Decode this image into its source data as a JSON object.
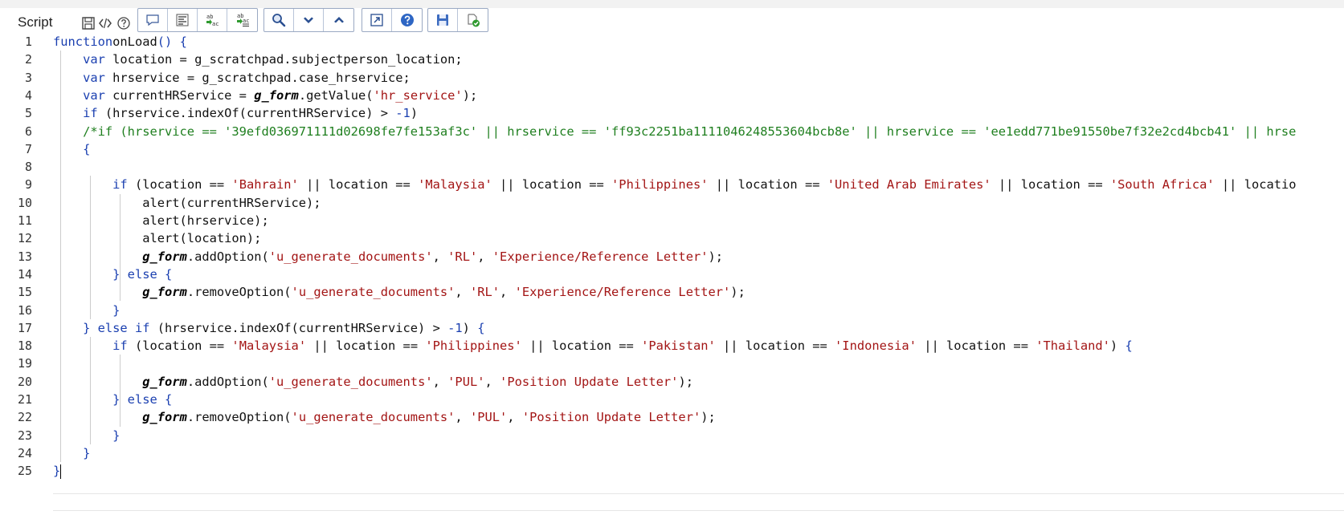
{
  "header": {
    "title": "Script"
  },
  "toolbar": {
    "mini_icons": [
      "save-icon",
      "code-icon",
      "help-icon"
    ],
    "groups": [
      [
        "comment-icon",
        "format-icon",
        "replace-icon",
        "replace-all-icon"
      ],
      [
        "search-icon",
        "next-icon",
        "previous-icon"
      ],
      [
        "fullscreen-icon",
        "help-icon"
      ],
      [
        "save-icon",
        "check-icon"
      ]
    ]
  },
  "editor": {
    "lines": [
      {
        "n": "1",
        "tokens": [
          [
            "k",
            "function"
          ],
          [
            "",
            "onLoad"
          ],
          [
            "k",
            "()"
          ],
          [
            "",
            ""
          ],
          [
            "k",
            "{"
          ]
        ]
      },
      {
        "n": "2",
        "tokens": [
          [
            "",
            "    "
          ],
          [
            "k",
            "var"
          ],
          [
            "",
            " location = g_scratchpad.subjectperson_location;"
          ]
        ]
      },
      {
        "n": "3",
        "tokens": [
          [
            "",
            "    "
          ],
          [
            "k",
            "var"
          ],
          [
            "",
            " hrservice = g_scratchpad.case_hrservice;"
          ]
        ]
      },
      {
        "n": "4",
        "tokens": [
          [
            "",
            "    "
          ],
          [
            "k",
            "var"
          ],
          [
            "",
            " currentHRService = "
          ],
          [
            "b",
            "g_form"
          ],
          [
            "",
            ".getValue("
          ],
          [
            "s",
            "'hr_service'"
          ],
          [
            "",
            ");"
          ]
        ]
      },
      {
        "n": "5",
        "tokens": [
          [
            "",
            "    "
          ],
          [
            "k",
            "if"
          ],
          [
            "",
            " (hrservice.indexOf(currentHRService) > "
          ],
          [
            "n",
            "-1"
          ],
          [
            "",
            ")"
          ]
        ]
      },
      {
        "n": "6",
        "tokens": [
          [
            "",
            "    "
          ],
          [
            "c",
            "/*if (hrservice == '39efd036971111d02698fe7fe153af3c' || hrservice == 'ff93c2251ba1111046248553604bcb8e' || hrservice == 'ee1edd771be91550be7f32e2cd4bcb41' || hrse"
          ]
        ]
      },
      {
        "n": "7",
        "tokens": [
          [
            "",
            "    "
          ],
          [
            "k",
            "{"
          ]
        ]
      },
      {
        "n": "8",
        "tokens": [
          [
            "",
            ""
          ]
        ]
      },
      {
        "n": "9",
        "tokens": [
          [
            "",
            "        "
          ],
          [
            "k",
            "if"
          ],
          [
            "",
            " (location == "
          ],
          [
            "s",
            "'Bahrain'"
          ],
          [
            "",
            " || location == "
          ],
          [
            "s",
            "'Malaysia'"
          ],
          [
            "",
            " || location == "
          ],
          [
            "s",
            "'Philippines'"
          ],
          [
            "",
            " || location == "
          ],
          [
            "s",
            "'United Arab Emirates'"
          ],
          [
            "",
            " || location == "
          ],
          [
            "s",
            "'South Africa'"
          ],
          [
            "",
            " || locatio"
          ]
        ]
      },
      {
        "n": "10",
        "tokens": [
          [
            "",
            "            alert(currentHRService);"
          ]
        ]
      },
      {
        "n": "11",
        "tokens": [
          [
            "",
            "            alert(hrservice);"
          ]
        ]
      },
      {
        "n": "12",
        "tokens": [
          [
            "",
            "            alert(location);"
          ]
        ]
      },
      {
        "n": "13",
        "tokens": [
          [
            "",
            "            "
          ],
          [
            "b",
            "g_form"
          ],
          [
            "",
            ".addOption("
          ],
          [
            "s",
            "'u_generate_documents'"
          ],
          [
            "",
            ", "
          ],
          [
            "s",
            "'RL'"
          ],
          [
            "",
            ", "
          ],
          [
            "s",
            "'Experience/Reference Letter'"
          ],
          [
            "",
            ");"
          ]
        ]
      },
      {
        "n": "14",
        "tokens": [
          [
            "",
            "        "
          ],
          [
            "k",
            "} else {"
          ]
        ]
      },
      {
        "n": "15",
        "tokens": [
          [
            "",
            "            "
          ],
          [
            "b",
            "g_form"
          ],
          [
            "",
            ".removeOption("
          ],
          [
            "s",
            "'u_generate_documents'"
          ],
          [
            "",
            ", "
          ],
          [
            "s",
            "'RL'"
          ],
          [
            "",
            ", "
          ],
          [
            "s",
            "'Experience/Reference Letter'"
          ],
          [
            "",
            ");"
          ]
        ]
      },
      {
        "n": "16",
        "tokens": [
          [
            "",
            "        "
          ],
          [
            "k",
            "}"
          ]
        ]
      },
      {
        "n": "17",
        "tokens": [
          [
            "",
            "    "
          ],
          [
            "k",
            "} else if"
          ],
          [
            "",
            " (hrservice.indexOf(currentHRService) > "
          ],
          [
            "n",
            "-1"
          ],
          [
            "",
            ") "
          ],
          [
            "k",
            "{"
          ]
        ]
      },
      {
        "n": "18",
        "tokens": [
          [
            "",
            "        "
          ],
          [
            "k",
            "if"
          ],
          [
            "",
            " (location == "
          ],
          [
            "s",
            "'Malaysia'"
          ],
          [
            "",
            " || location == "
          ],
          [
            "s",
            "'Philippines'"
          ],
          [
            "",
            " || location == "
          ],
          [
            "s",
            "'Pakistan'"
          ],
          [
            "",
            " || location == "
          ],
          [
            "s",
            "'Indonesia'"
          ],
          [
            "",
            " || location == "
          ],
          [
            "s",
            "'Thailand'"
          ],
          [
            "",
            ") "
          ],
          [
            "k",
            "{"
          ]
        ]
      },
      {
        "n": "19",
        "tokens": [
          [
            "",
            ""
          ]
        ]
      },
      {
        "n": "20",
        "tokens": [
          [
            "",
            "            "
          ],
          [
            "b",
            "g_form"
          ],
          [
            "",
            ".addOption("
          ],
          [
            "s",
            "'u_generate_documents'"
          ],
          [
            "",
            ", "
          ],
          [
            "s",
            "'PUL'"
          ],
          [
            "",
            ", "
          ],
          [
            "s",
            "'Position Update Letter'"
          ],
          [
            "",
            ");"
          ]
        ]
      },
      {
        "n": "21",
        "tokens": [
          [
            "",
            "        "
          ],
          [
            "k",
            "} else {"
          ]
        ]
      },
      {
        "n": "22",
        "tokens": [
          [
            "",
            "            "
          ],
          [
            "b",
            "g_form"
          ],
          [
            "",
            ".removeOption("
          ],
          [
            "s",
            "'u_generate_documents'"
          ],
          [
            "",
            ", "
          ],
          [
            "s",
            "'PUL'"
          ],
          [
            "",
            ", "
          ],
          [
            "s",
            "'Position Update Letter'"
          ],
          [
            "",
            ");"
          ]
        ]
      },
      {
        "n": "23",
        "tokens": [
          [
            "",
            "        "
          ],
          [
            "k",
            "}"
          ]
        ]
      },
      {
        "n": "24",
        "tokens": [
          [
            "",
            "    "
          ],
          [
            "k",
            "}"
          ]
        ]
      },
      {
        "n": "25",
        "tokens": [
          [
            "k",
            "}"
          ]
        ]
      }
    ]
  }
}
